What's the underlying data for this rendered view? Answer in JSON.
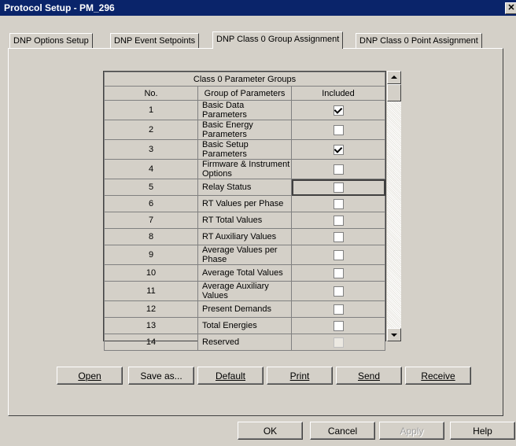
{
  "window": {
    "title": "Protocol Setup - PM_296",
    "close_glyph": "✕"
  },
  "tabs": [
    {
      "label": "DNP Options Setup"
    },
    {
      "label": "DNP Event Setpoints"
    },
    {
      "label": "DNP Class 0 Group Assignment"
    },
    {
      "label": "DNP Class 0 Point Assignment"
    }
  ],
  "grid": {
    "caption": "Class 0 Parameter Groups",
    "columns": [
      "No.",
      "Group of Parameters",
      "Included"
    ],
    "rows": [
      {
        "no": "1",
        "name": "Basic Data Parameters",
        "included": true
      },
      {
        "no": "2",
        "name": "Basic Energy Parameters",
        "included": false
      },
      {
        "no": "3",
        "name": "Basic Setup Parameters",
        "included": true
      },
      {
        "no": "4",
        "name": "Firmware & Instrument Options",
        "included": false
      },
      {
        "no": "5",
        "name": "Relay Status",
        "included": false
      },
      {
        "no": "6",
        "name": "RT Values per Phase",
        "included": false
      },
      {
        "no": "7",
        "name": "RT Total Values",
        "included": false
      },
      {
        "no": "8",
        "name": "RT Auxiliary Values",
        "included": false
      },
      {
        "no": "9",
        "name": "Average Values per Phase",
        "included": false
      },
      {
        "no": "10",
        "name": "Average Total Values",
        "included": false
      },
      {
        "no": "11",
        "name": "Average Auxiliary Values",
        "included": false
      },
      {
        "no": "12",
        "name": "Present Demands",
        "included": false
      },
      {
        "no": "13",
        "name": "Total Energies",
        "included": false
      },
      {
        "no": "14",
        "name": "Reserved",
        "included": false
      }
    ]
  },
  "file_buttons": {
    "open": "Open",
    "save_as": "Save as...",
    "default": "Default",
    "print": "Print",
    "send": "Send",
    "receive": "Receive"
  },
  "dialog_buttons": {
    "ok": "OK",
    "cancel": "Cancel",
    "apply": "Apply",
    "help": "Help"
  }
}
